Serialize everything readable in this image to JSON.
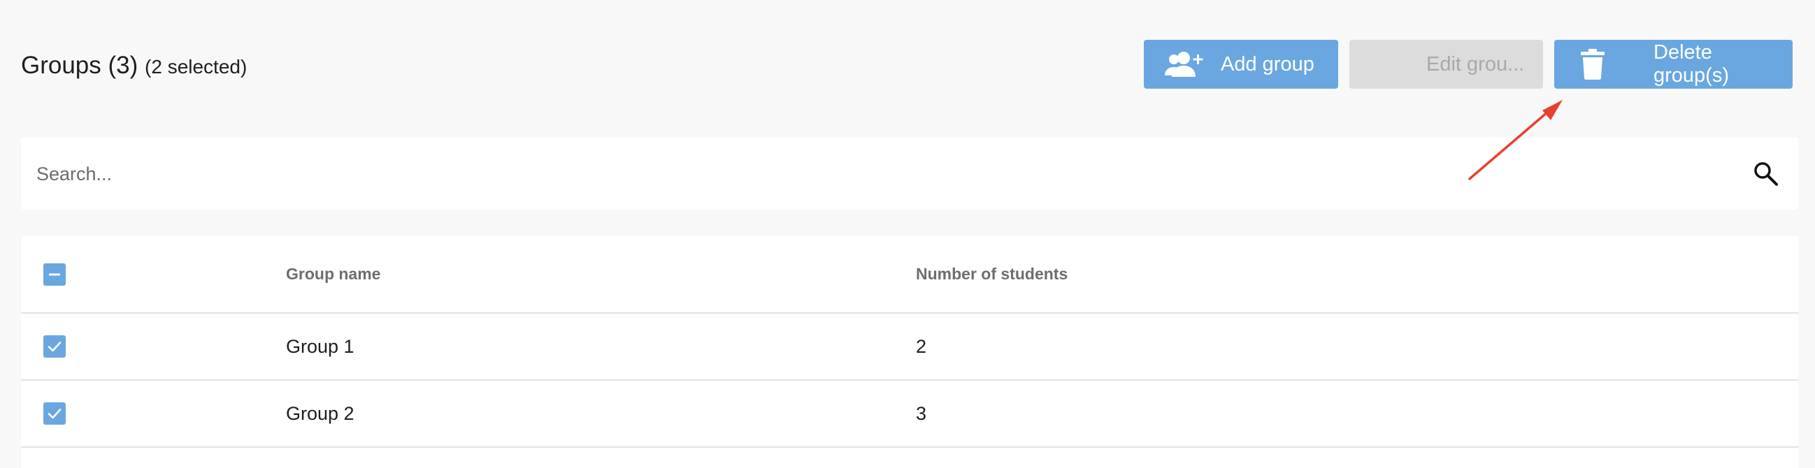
{
  "header": {
    "title": "Groups (3)",
    "selection_count": "(2 selected)"
  },
  "toolbar": {
    "add_label": "Add group",
    "edit_label": "Edit grou...",
    "delete_label": "Delete group(s)",
    "add_icon": "add-person-icon",
    "delete_icon": "trash-icon"
  },
  "search": {
    "placeholder": "Search...",
    "value": "",
    "icon": "search-icon"
  },
  "table": {
    "columns": [
      "Group name",
      "Number of students"
    ],
    "header_checkbox_state": "indeterminate",
    "rows": [
      {
        "name": "Group 1",
        "students": "2",
        "checked": true
      },
      {
        "name": "Group 2",
        "students": "3",
        "checked": true
      }
    ]
  },
  "colors": {
    "accent": "#6aa7e0",
    "disabled": "#dcdcdc",
    "annotation": "#e8402f"
  }
}
